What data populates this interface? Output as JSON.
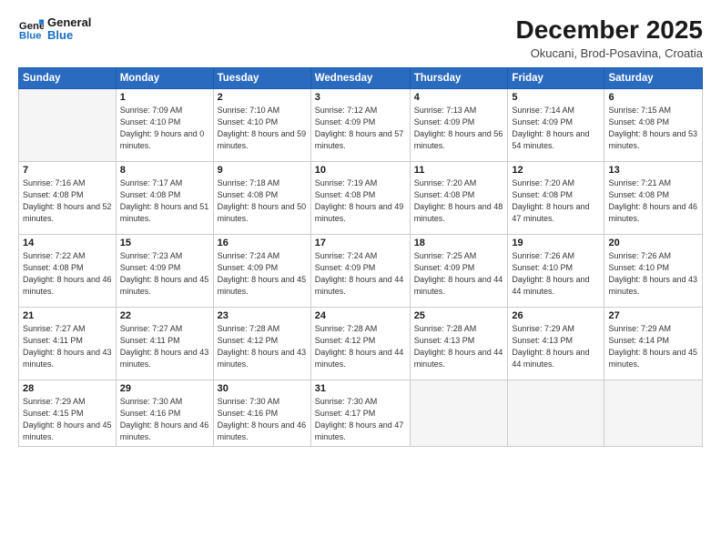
{
  "header": {
    "logo_line1": "General",
    "logo_line2": "Blue",
    "month": "December 2025",
    "location": "Okucani, Brod-Posavina, Croatia"
  },
  "weekdays": [
    "Sunday",
    "Monday",
    "Tuesday",
    "Wednesday",
    "Thursday",
    "Friday",
    "Saturday"
  ],
  "weeks": [
    [
      {
        "day": "",
        "empty": true
      },
      {
        "day": "1",
        "sunrise": "7:09 AM",
        "sunset": "4:10 PM",
        "daylight": "9 hours and 0 minutes."
      },
      {
        "day": "2",
        "sunrise": "7:10 AM",
        "sunset": "4:10 PM",
        "daylight": "8 hours and 59 minutes."
      },
      {
        "day": "3",
        "sunrise": "7:12 AM",
        "sunset": "4:09 PM",
        "daylight": "8 hours and 57 minutes."
      },
      {
        "day": "4",
        "sunrise": "7:13 AM",
        "sunset": "4:09 PM",
        "daylight": "8 hours and 56 minutes."
      },
      {
        "day": "5",
        "sunrise": "7:14 AM",
        "sunset": "4:09 PM",
        "daylight": "8 hours and 54 minutes."
      },
      {
        "day": "6",
        "sunrise": "7:15 AM",
        "sunset": "4:08 PM",
        "daylight": "8 hours and 53 minutes."
      }
    ],
    [
      {
        "day": "7",
        "sunrise": "7:16 AM",
        "sunset": "4:08 PM",
        "daylight": "8 hours and 52 minutes."
      },
      {
        "day": "8",
        "sunrise": "7:17 AM",
        "sunset": "4:08 PM",
        "daylight": "8 hours and 51 minutes."
      },
      {
        "day": "9",
        "sunrise": "7:18 AM",
        "sunset": "4:08 PM",
        "daylight": "8 hours and 50 minutes."
      },
      {
        "day": "10",
        "sunrise": "7:19 AM",
        "sunset": "4:08 PM",
        "daylight": "8 hours and 49 minutes."
      },
      {
        "day": "11",
        "sunrise": "7:20 AM",
        "sunset": "4:08 PM",
        "daylight": "8 hours and 48 minutes."
      },
      {
        "day": "12",
        "sunrise": "7:20 AM",
        "sunset": "4:08 PM",
        "daylight": "8 hours and 47 minutes."
      },
      {
        "day": "13",
        "sunrise": "7:21 AM",
        "sunset": "4:08 PM",
        "daylight": "8 hours and 46 minutes."
      }
    ],
    [
      {
        "day": "14",
        "sunrise": "7:22 AM",
        "sunset": "4:08 PM",
        "daylight": "8 hours and 46 minutes."
      },
      {
        "day": "15",
        "sunrise": "7:23 AM",
        "sunset": "4:09 PM",
        "daylight": "8 hours and 45 minutes."
      },
      {
        "day": "16",
        "sunrise": "7:24 AM",
        "sunset": "4:09 PM",
        "daylight": "8 hours and 45 minutes."
      },
      {
        "day": "17",
        "sunrise": "7:24 AM",
        "sunset": "4:09 PM",
        "daylight": "8 hours and 44 minutes."
      },
      {
        "day": "18",
        "sunrise": "7:25 AM",
        "sunset": "4:09 PM",
        "daylight": "8 hours and 44 minutes."
      },
      {
        "day": "19",
        "sunrise": "7:26 AM",
        "sunset": "4:10 PM",
        "daylight": "8 hours and 44 minutes."
      },
      {
        "day": "20",
        "sunrise": "7:26 AM",
        "sunset": "4:10 PM",
        "daylight": "8 hours and 43 minutes."
      }
    ],
    [
      {
        "day": "21",
        "sunrise": "7:27 AM",
        "sunset": "4:11 PM",
        "daylight": "8 hours and 43 minutes."
      },
      {
        "day": "22",
        "sunrise": "7:27 AM",
        "sunset": "4:11 PM",
        "daylight": "8 hours and 43 minutes."
      },
      {
        "day": "23",
        "sunrise": "7:28 AM",
        "sunset": "4:12 PM",
        "daylight": "8 hours and 43 minutes."
      },
      {
        "day": "24",
        "sunrise": "7:28 AM",
        "sunset": "4:12 PM",
        "daylight": "8 hours and 44 minutes."
      },
      {
        "day": "25",
        "sunrise": "7:28 AM",
        "sunset": "4:13 PM",
        "daylight": "8 hours and 44 minutes."
      },
      {
        "day": "26",
        "sunrise": "7:29 AM",
        "sunset": "4:13 PM",
        "daylight": "8 hours and 44 minutes."
      },
      {
        "day": "27",
        "sunrise": "7:29 AM",
        "sunset": "4:14 PM",
        "daylight": "8 hours and 45 minutes."
      }
    ],
    [
      {
        "day": "28",
        "sunrise": "7:29 AM",
        "sunset": "4:15 PM",
        "daylight": "8 hours and 45 minutes."
      },
      {
        "day": "29",
        "sunrise": "7:30 AM",
        "sunset": "4:16 PM",
        "daylight": "8 hours and 46 minutes."
      },
      {
        "day": "30",
        "sunrise": "7:30 AM",
        "sunset": "4:16 PM",
        "daylight": "8 hours and 46 minutes."
      },
      {
        "day": "31",
        "sunrise": "7:30 AM",
        "sunset": "4:17 PM",
        "daylight": "8 hours and 47 minutes."
      },
      {
        "day": "",
        "empty": true
      },
      {
        "day": "",
        "empty": true
      },
      {
        "day": "",
        "empty": true
      }
    ]
  ]
}
